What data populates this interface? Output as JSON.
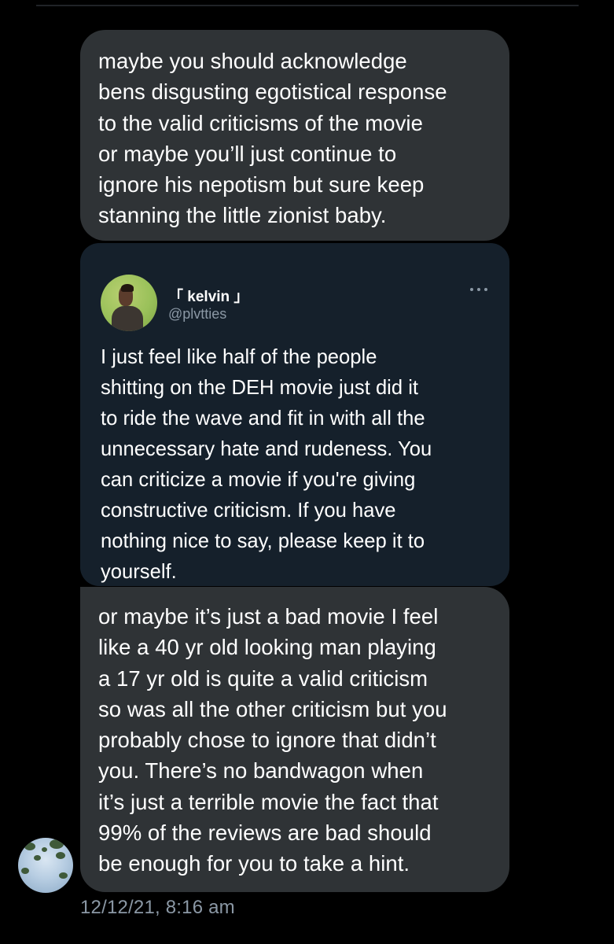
{
  "messages": [
    {
      "text": "maybe you should acknowledge\nbens disgusting egotistical response\nto the valid criticisms of the movie\nor maybe you’ll just continue to\nignore his nepotism but sure keep\nstanning the little zionist baby."
    },
    {
      "text": "or maybe it’s just a bad movie I feel\nlike a 40 yr old looking man playing\na 17 yr old is quite a valid criticism\nso was all the other criticism but you\nprobably chose to ignore that didn’t\nyou. There’s no bandwagon when\nit’s just a terrible movie the fact that\n99% of the reviews are bad should\nbe enough for you to take a hint."
    }
  ],
  "quoted_tweet": {
    "display_name": "「 kelvin 」",
    "handle": "@plvtties",
    "text": "I just feel like half of the people\nshitting on the DEH movie just did it\nto ride the wave and fit in with all the\nunnecessary hate and rudeness. You\ncan criticize a movie if you're giving\nconstructive criticism. If you have\nnothing nice to say, please keep it to\nyourself.",
    "avatar_icon": "profile-photo-icon",
    "more_icon": "more-options-icon"
  },
  "timestamp": "12/12/21, 8:16 am",
  "colors": {
    "background": "#000000",
    "bubble": "#2f3336",
    "quote_card": "#15202b",
    "secondary_text": "#8b98a5",
    "primary_text": "#ffffff"
  }
}
